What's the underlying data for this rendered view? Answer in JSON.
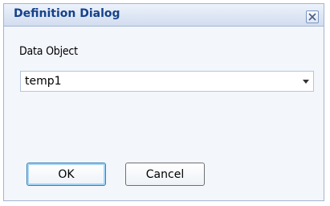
{
  "dialog": {
    "title": "Definition Dialog",
    "close_icon": "close-icon"
  },
  "form": {
    "label": "Data Object",
    "data_object": {
      "value": "temp1",
      "dropdown_icon": "chevron-down-icon"
    }
  },
  "buttons": {
    "ok": "OK",
    "cancel": "Cancel"
  },
  "colors": {
    "title_text": "#15428b",
    "dialog_border": "#a3b5d2",
    "content_bg": "#f3f6fb"
  }
}
